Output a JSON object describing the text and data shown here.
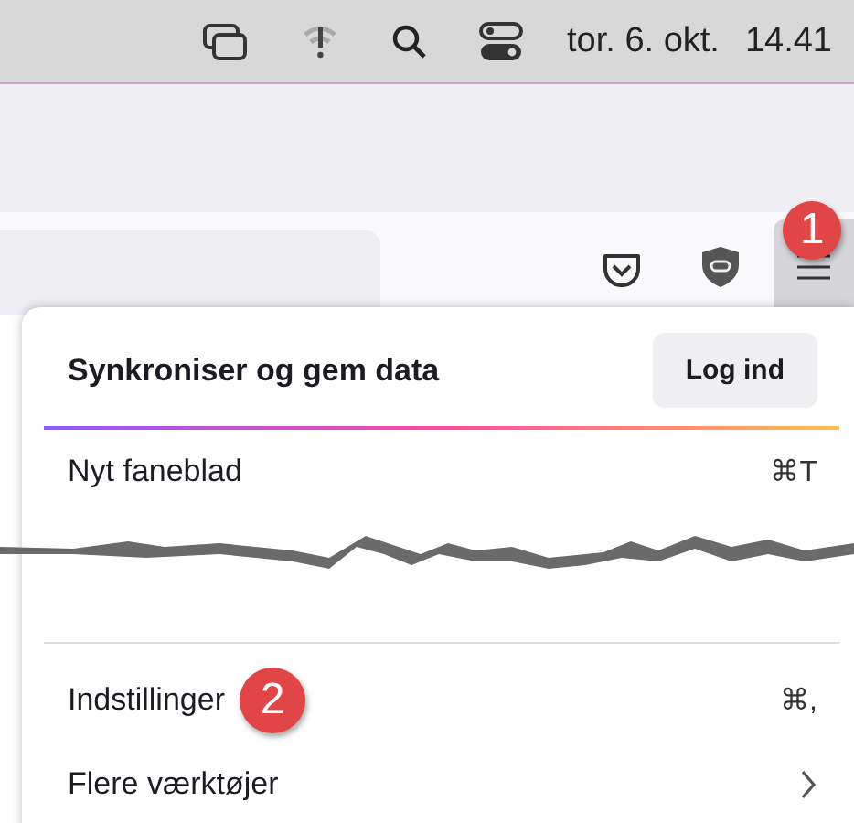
{
  "menu_bar": {
    "date": "tor. 6. okt.",
    "time": "14.41"
  },
  "toolbar": {
    "annotation": "1"
  },
  "menu": {
    "header": {
      "title": "Synkroniser og gem data",
      "button": "Log ind"
    },
    "items": [
      {
        "kind": "item",
        "label": "Nyt faneblad",
        "shortcut": "⌘T"
      },
      {
        "kind": "torn"
      },
      {
        "kind": "divider"
      },
      {
        "kind": "item",
        "label": "Indstillinger",
        "annotation": "2",
        "shortcut": "⌘,"
      },
      {
        "kind": "submenu",
        "label": "Flere værktøjer"
      }
    ]
  }
}
